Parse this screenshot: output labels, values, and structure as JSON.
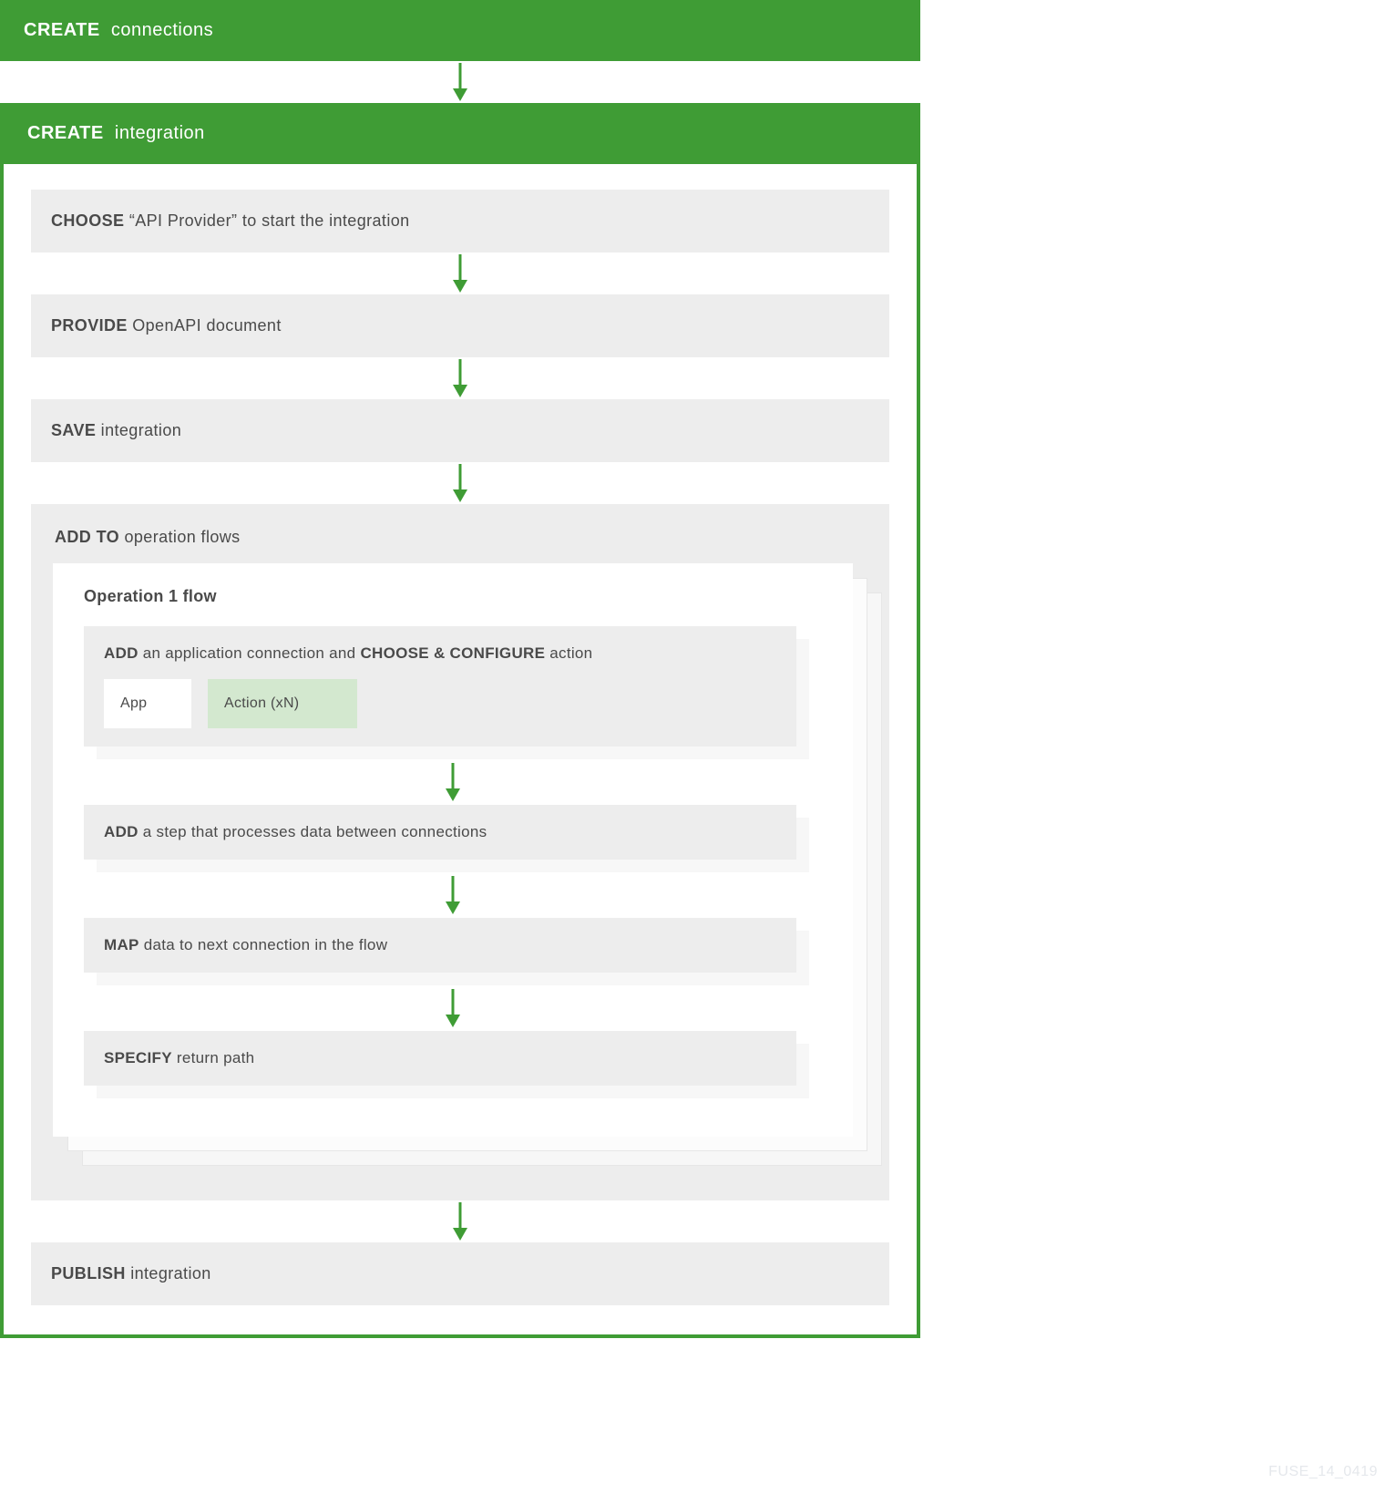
{
  "colors": {
    "green": "#3f9c35",
    "grey": "#ededed",
    "lightgreen": "#d3e8cf"
  },
  "footer_id": "FUSE_14_0419",
  "top_bar": {
    "bold": "CREATE",
    "rest": "connections"
  },
  "integration_bar": {
    "bold": "CREATE",
    "rest": "integration"
  },
  "steps": {
    "choose": {
      "bold": "CHOOSE",
      "rest": "  “API Provider” to start the integration"
    },
    "provide": {
      "bold": "PROVIDE",
      "rest": " OpenAPI document"
    },
    "save": {
      "bold": "SAVE",
      "rest": " integration"
    },
    "publish": {
      "bold": "PUBLISH",
      "rest": " integration"
    }
  },
  "addto": {
    "title_bold": "ADD TO",
    "title_rest": " operation flows",
    "opflow_title": "Operation 1 flow",
    "add_action": {
      "b1": "ADD",
      "t1": " an application connection and ",
      "b2": "CHOOSE & CONFIGURE",
      "t2": " action",
      "app_label": "App",
      "action_label": "Action (xN)"
    },
    "add_step": {
      "bold": "ADD",
      "rest": " a step that processes data between connections"
    },
    "map": {
      "bold": "MAP",
      "rest": " data to next connection in the flow"
    },
    "specify": {
      "bold": "SPECIFY",
      "rest": " return path"
    }
  }
}
